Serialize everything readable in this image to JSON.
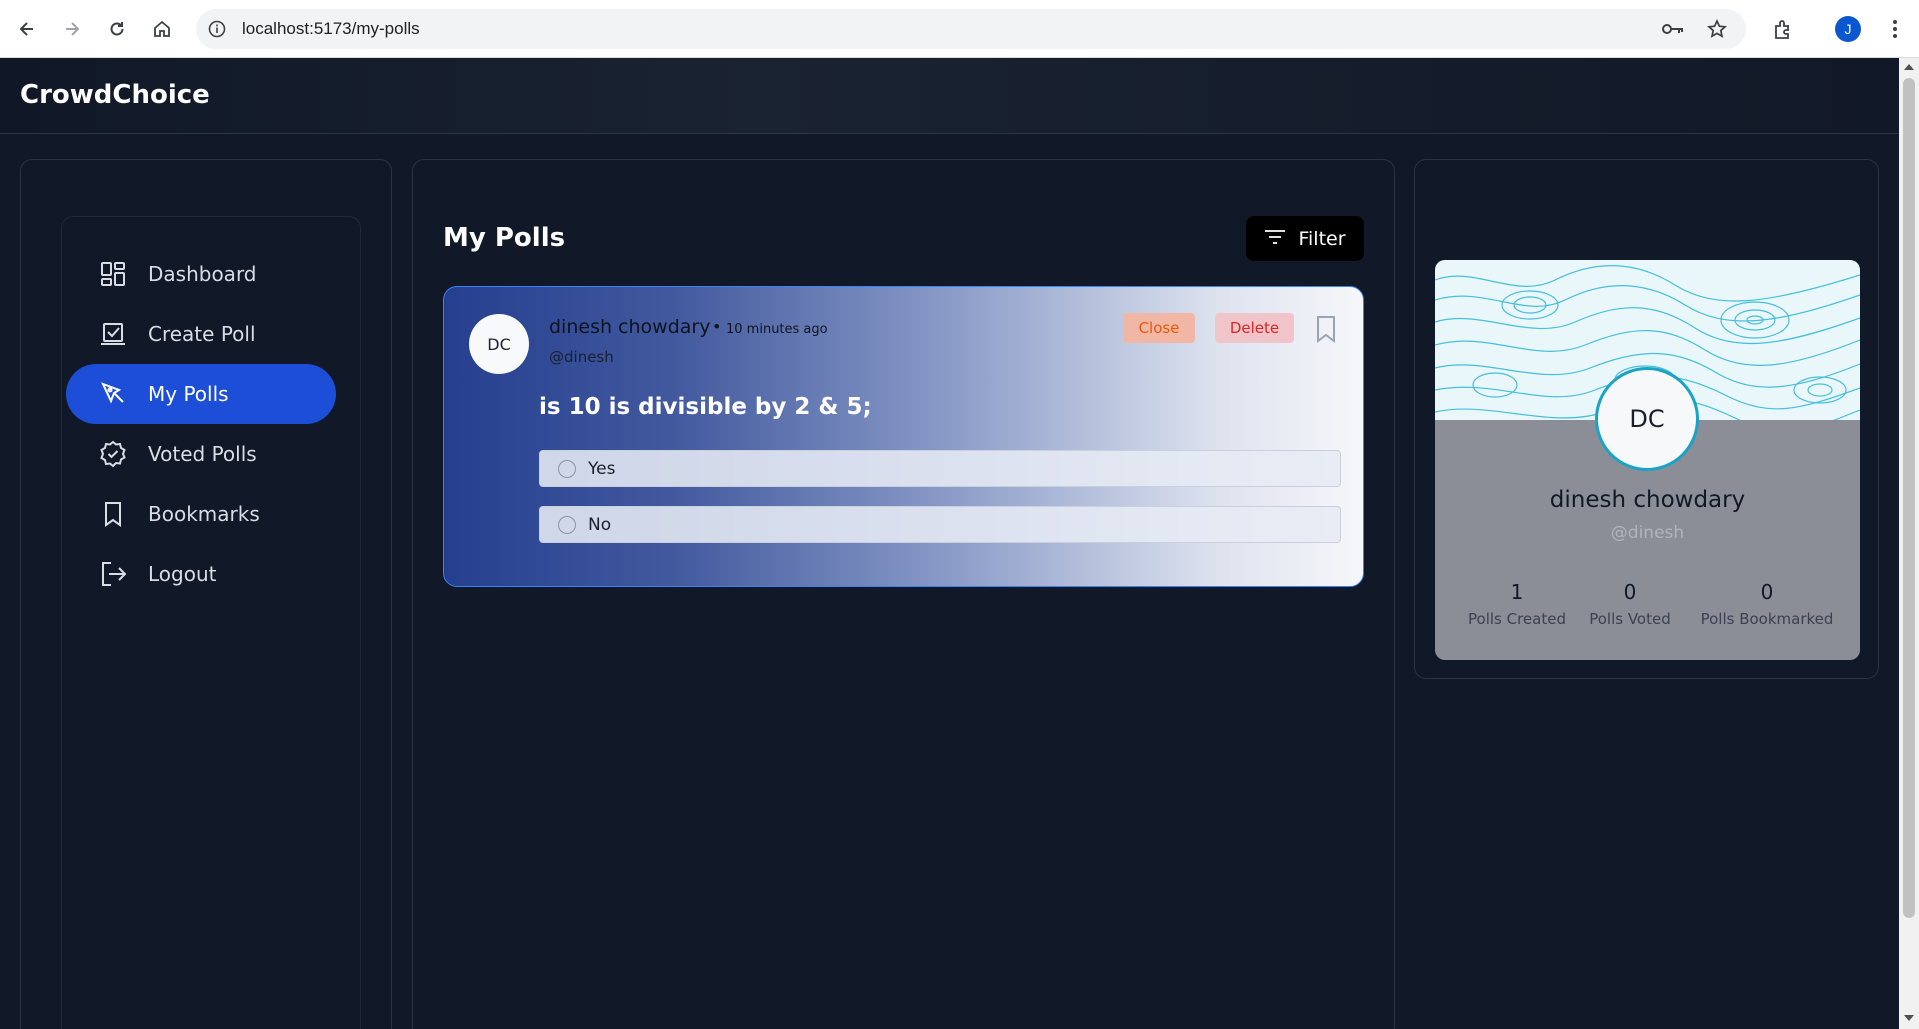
{
  "browser": {
    "url": "localhost:5173/my-polls",
    "profile_initial": "J"
  },
  "app": {
    "brand": "CrowdChoice"
  },
  "sidebar": {
    "items": [
      {
        "label": "Dashboard",
        "icon": "dashboard-icon"
      },
      {
        "label": "Create Poll",
        "icon": "create-poll-icon"
      },
      {
        "label": "My Polls",
        "icon": "my-polls-icon",
        "active": true
      },
      {
        "label": "Voted Polls",
        "icon": "voted-polls-icon"
      },
      {
        "label": "Bookmarks",
        "icon": "bookmark-icon"
      },
      {
        "label": "Logout",
        "icon": "logout-icon"
      }
    ]
  },
  "main": {
    "title": "My Polls",
    "filter_label": "Filter",
    "poll": {
      "avatar_initials": "DC",
      "author": "dinesh chowdary",
      "separator": "•",
      "time": "10 minutes ago",
      "handle": "@dinesh",
      "close_label": "Close",
      "delete_label": "Delete",
      "question": "is 10 is divisible by 2 & 5;",
      "options": [
        "Yes",
        "No"
      ]
    }
  },
  "profile": {
    "initials": "DC",
    "name": "dinesh chowdary",
    "handle": "@dinesh",
    "stats": [
      {
        "value": "1",
        "label": "Polls Created"
      },
      {
        "value": "0",
        "label": "Polls Voted"
      },
      {
        "value": "0",
        "label": "Polls Bookmarked"
      }
    ]
  },
  "colors": {
    "accent": "#1d4ed8",
    "background": "#111827",
    "close": "#ea580c",
    "delete": "#dc2626",
    "avatar_ring": "#1aa3c4"
  }
}
